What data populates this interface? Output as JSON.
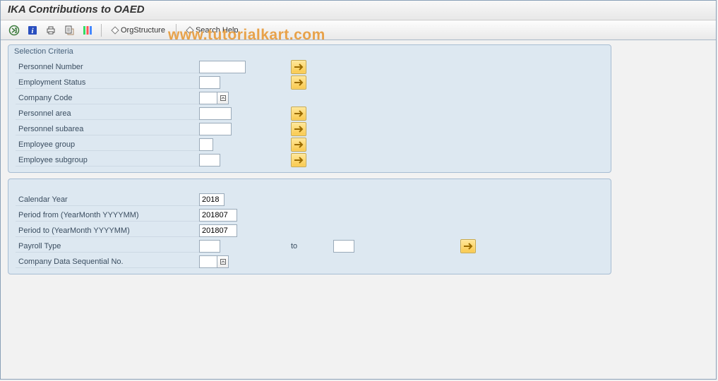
{
  "title": "IKA Contributions to OAED",
  "watermark": "www.tutorialkart.com",
  "toolbar": {
    "org_structure": "OrgStructure",
    "search_help": "Search Help"
  },
  "group1": {
    "title": "Selection Criteria",
    "personnel_number_lbl": "Personnel Number",
    "employment_status_lbl": "Employment Status",
    "company_code_lbl": "Company Code",
    "personnel_area_lbl": "Personnel area",
    "personnel_subarea_lbl": "Personnel subarea",
    "employee_group_lbl": "Employee group",
    "employee_subgroup_lbl": "Employee subgroup",
    "personnel_number": "",
    "employment_status": "",
    "company_code": "",
    "personnel_area": "",
    "personnel_subarea": "",
    "employee_group": "",
    "employee_subgroup": ""
  },
  "group2": {
    "calendar_year_lbl": "Calendar Year",
    "period_from_lbl": "Period from (YearMonth YYYYMM)",
    "period_to_lbl": "Period to (YearMonth YYYYMM)",
    "payroll_type_lbl": "Payroll Type",
    "to_lbl": "to",
    "company_data_seq_lbl": "Company Data Sequential No.",
    "calendar_year": "2018",
    "period_from": "201807",
    "period_to": "201807",
    "payroll_type_low": "",
    "payroll_type_high": "",
    "company_data_seq": ""
  }
}
